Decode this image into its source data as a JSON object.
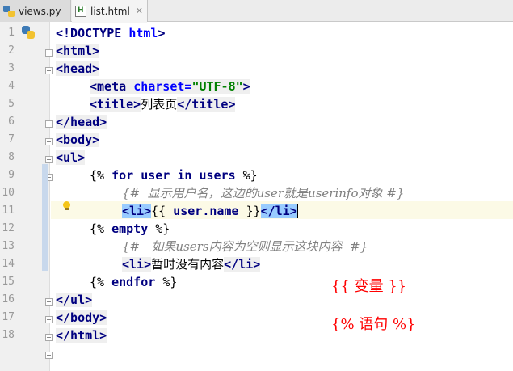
{
  "tabs": [
    {
      "label": "views.py",
      "active": false
    },
    {
      "label": "list.html",
      "active": true
    }
  ],
  "editor": {
    "line_numbers": [
      "1",
      "2",
      "3",
      "4",
      "5",
      "6",
      "7",
      "8",
      "9",
      "10",
      "11",
      "12",
      "13",
      "14",
      "15",
      "16",
      "17",
      "18"
    ],
    "current_line": "11",
    "lines": {
      "l1": {
        "doctype": "<!DOCTYPE",
        "html": "html",
        "close": ">"
      },
      "l2": "<html>",
      "l3": "<head>",
      "l4": {
        "open": "<meta",
        "attr": "charset=",
        "value": "\"UTF-8\"",
        "close": ">"
      },
      "l5": {
        "open": "<title>",
        "text": "列表页",
        "close": "</title>"
      },
      "l6": "</head>",
      "l7": "<body>",
      "l8": "<ul>",
      "l9": {
        "open": "{%",
        "for": "for",
        "item": "user",
        "in": "in",
        "seq": "users",
        "close": "%}"
      },
      "l10": "{#  显示用户名，这边的user就是userinfo对象 #}",
      "l11": {
        "open": "<li>",
        "var_open": "{{",
        "var": "user.name",
        "var_close": "}}",
        "close": "</li>"
      },
      "l12": {
        "open": "{%",
        "kw": "empty",
        "close": "%}"
      },
      "l13": "{#   如果users内容为空则显示这块内容  #}",
      "l14": {
        "open": "<li>",
        "text": "暂时没有内容",
        "close": "</li>"
      },
      "l15": {
        "open": "{%",
        "kw": "endfor",
        "close": "%}"
      },
      "l16": "</ul>",
      "l17": "</body>",
      "l18": "</html>"
    }
  },
  "annotations": {
    "variable_note": "{{ 变量 }}",
    "statement_note": "{% 语句 %}"
  },
  "colors": {
    "tag": "#000080",
    "attribute": "#0000ff",
    "string": "#008000",
    "comment": "#808080",
    "annotation": "#ff0000",
    "bracket_match": "#99ccff",
    "caret_line": "#fcfae6"
  },
  "icons": [
    "python-file-icon",
    "html-file-icon",
    "close-icon",
    "lightbulb-icon",
    "python-badge-icon",
    "fold-marker-icon"
  ]
}
